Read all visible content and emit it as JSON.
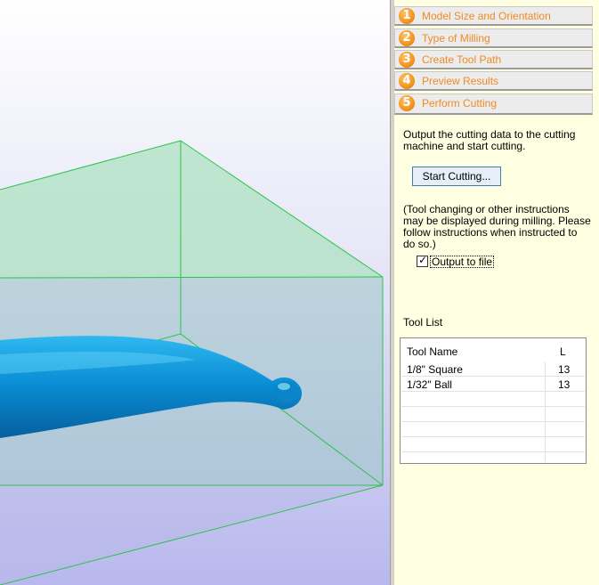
{
  "steps": [
    {
      "num": "1",
      "label": "Model Size and Orientation"
    },
    {
      "num": "2",
      "label": "Type of Milling"
    },
    {
      "num": "3",
      "label": "Create Tool Path"
    },
    {
      "num": "4",
      "label": "Preview Results"
    },
    {
      "num": "5",
      "label": "Perform Cutting"
    }
  ],
  "perform_cutting": {
    "description_line1": "Output the cutting data to the cutting",
    "description_line2": "machine and start cutting.",
    "start_button": "Start Cutting...",
    "note_line1": "(Tool changing or other instructions",
    "note_line2": "may be displayed during milling. Please",
    "note_line3": "follow instructions when instructed to",
    "note_line4": "do so.)",
    "output_to_file_label": "Output to file",
    "output_to_file_checked": true,
    "check_mark": "✓"
  },
  "tool_list": {
    "label": "Tool List",
    "columns": [
      "Tool Name",
      "L"
    ],
    "rows": [
      {
        "name": "1/8\" Square",
        "l": "13"
      },
      {
        "name": "1/32\" Ball",
        "l": "13"
      }
    ]
  },
  "colors": {
    "step_label": "#f08a24",
    "panel_background": "#ffffe1",
    "bounding_box_edge": "#2ec24a",
    "model": "#0f8fd6"
  }
}
